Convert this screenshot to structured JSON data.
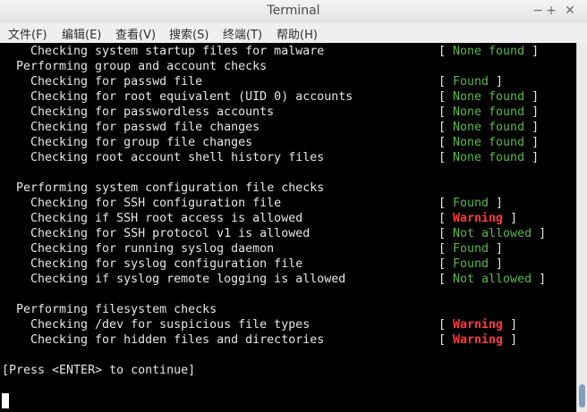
{
  "window": {
    "title": "Terminal",
    "controls": {
      "minimize": "−",
      "maximize": "+",
      "close": "✕"
    }
  },
  "menubar": [
    "文件(F)",
    "编辑(E)",
    "查看(V)",
    "搜索(S)",
    "终端(T)",
    "帮助(H)"
  ],
  "terminal": {
    "lines": [
      {
        "text": "Checking system startup files for malware",
        "indent": 2,
        "status": "None found",
        "color": "green"
      },
      {
        "text": "Performing group and account checks",
        "indent": 1
      },
      {
        "text": "Checking for passwd file",
        "indent": 2,
        "status": "Found",
        "color": "green"
      },
      {
        "text": "Checking for root equivalent (UID 0) accounts",
        "indent": 2,
        "status": "None found",
        "color": "green"
      },
      {
        "text": "Checking for passwordless accounts",
        "indent": 2,
        "status": "None found",
        "color": "green"
      },
      {
        "text": "Checking for passwd file changes",
        "indent": 2,
        "status": "None found",
        "color": "green"
      },
      {
        "text": "Checking for group file changes",
        "indent": 2,
        "status": "None found",
        "color": "green"
      },
      {
        "text": "Checking root account shell history files",
        "indent": 2,
        "status": "None found",
        "color": "green"
      },
      {
        "text": "",
        "indent": 0
      },
      {
        "text": "Performing system configuration file checks",
        "indent": 1
      },
      {
        "text": "Checking for SSH configuration file",
        "indent": 2,
        "status": "Found",
        "color": "green"
      },
      {
        "text": "Checking if SSH root access is allowed",
        "indent": 2,
        "status": "Warning",
        "color": "red"
      },
      {
        "text": "Checking for SSH protocol v1 is allowed",
        "indent": 2,
        "status": "Not allowed",
        "color": "green"
      },
      {
        "text": "Checking for running syslog daemon",
        "indent": 2,
        "status": "Found",
        "color": "green"
      },
      {
        "text": "Checking for syslog configuration file",
        "indent": 2,
        "status": "Found",
        "color": "green"
      },
      {
        "text": "Checking if syslog remote logging is allowed",
        "indent": 2,
        "status": "Not allowed",
        "color": "green"
      },
      {
        "text": "",
        "indent": 0
      },
      {
        "text": "Performing filesystem checks",
        "indent": 1
      },
      {
        "text": "Checking /dev for suspicious file types",
        "indent": 2,
        "status": "Warning",
        "color": "red"
      },
      {
        "text": "Checking for hidden files and directories",
        "indent": 2,
        "status": "Warning",
        "color": "red"
      },
      {
        "text": "",
        "indent": 0
      },
      {
        "text": "[Press <ENTER> to continue]",
        "indent": 0
      }
    ]
  }
}
